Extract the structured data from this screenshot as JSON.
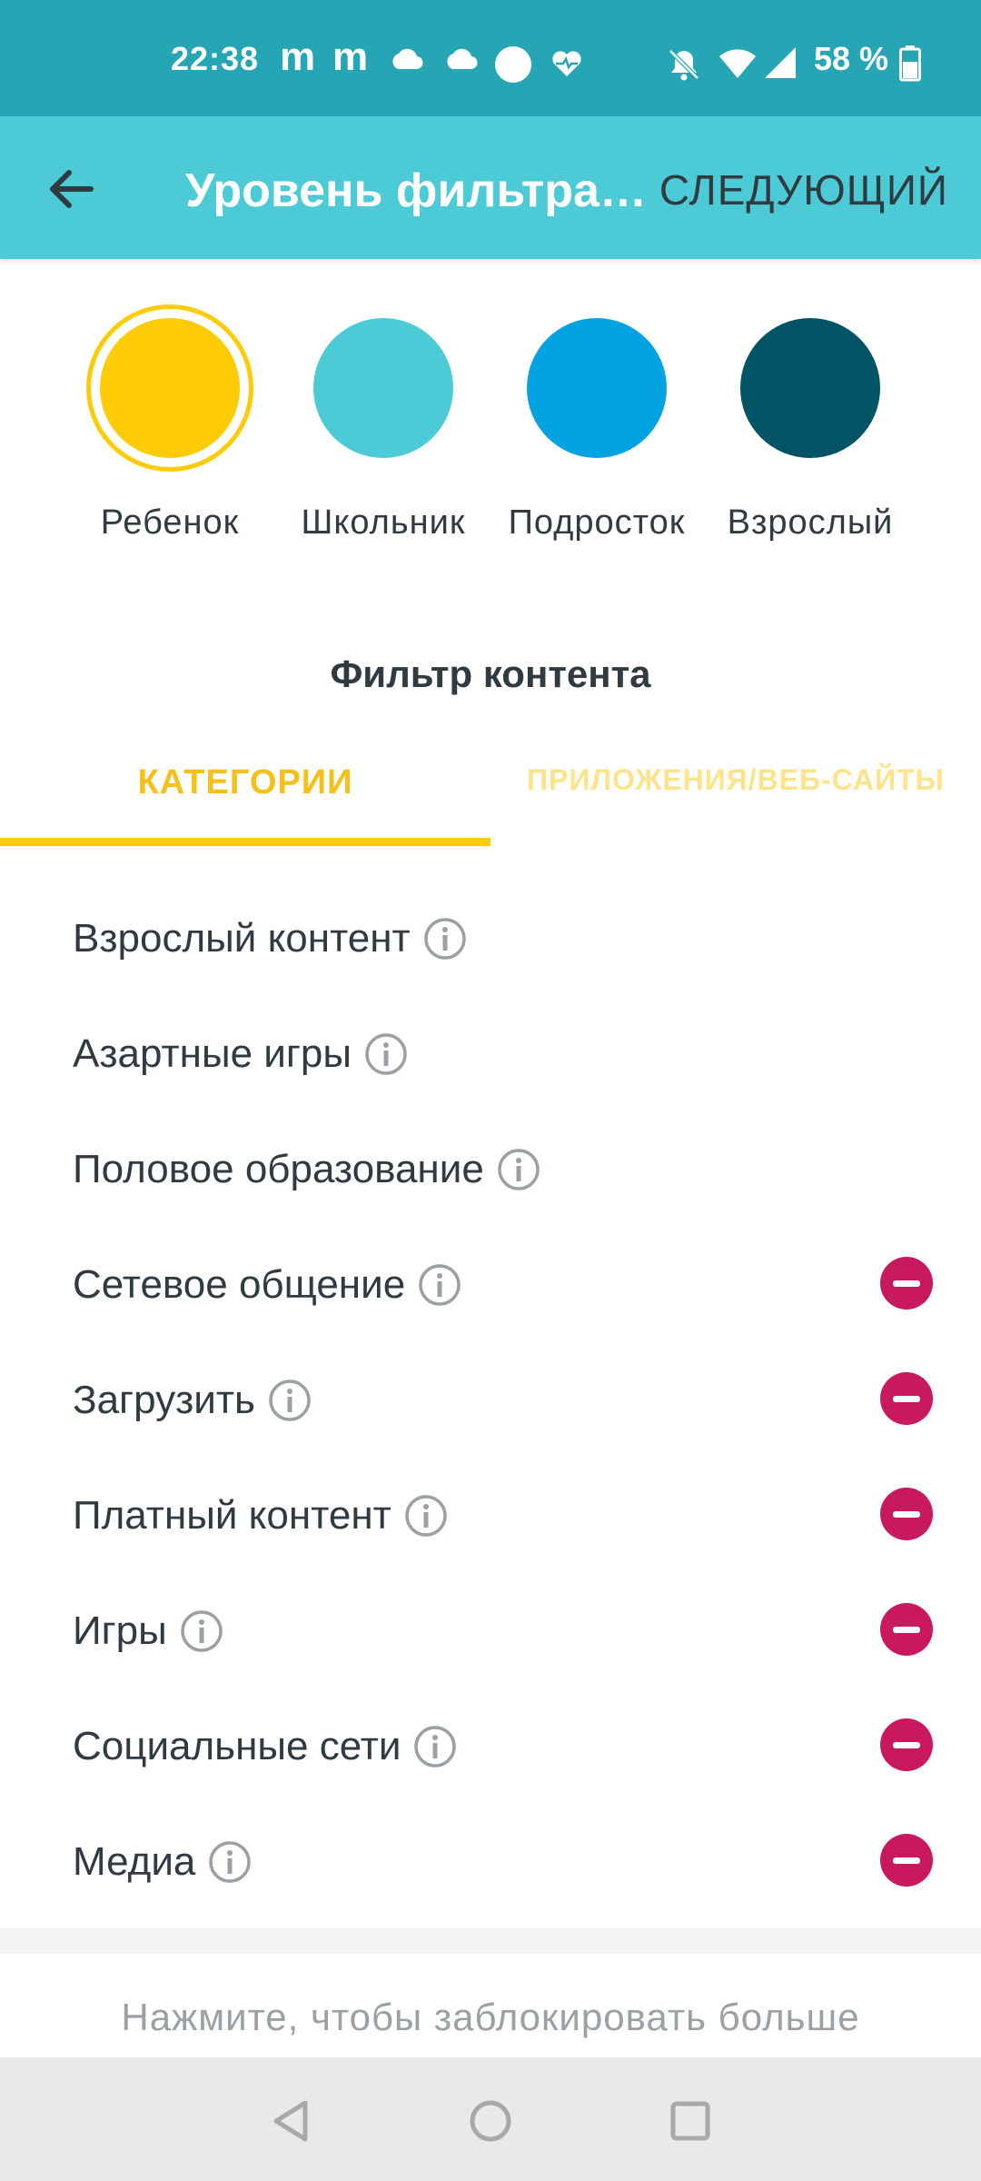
{
  "status_bar": {
    "time": "22:38",
    "notif_m1": "m",
    "notif_m2": "m",
    "battery_percent": "58 %",
    "icons": [
      "cloud-icon",
      "cloud-icon",
      "circle-icon",
      "heart-pulse-icon",
      "bell-off-icon",
      "wifi-icon",
      "signal-icon",
      "battery-icon"
    ]
  },
  "app_bar": {
    "title": "Уровень фильтрации",
    "next_label": "СЛЕДУЮЩИЙ",
    "back_icon": "arrow-left-icon",
    "background": "#4ccad6"
  },
  "levels": [
    {
      "label": "Ребенок",
      "color": "#ffcb05",
      "selected": true
    },
    {
      "label": "Школьник",
      "color": "#4ccad6",
      "selected": false
    },
    {
      "label": "Подросток",
      "color": "#03a3e2",
      "selected": false
    },
    {
      "label": "Взрослый",
      "color": "#005466",
      "selected": false
    }
  ],
  "content_filter": {
    "title": "Фильтр контента",
    "tabs": [
      {
        "label": "КАТЕГОРИИ",
        "active": true
      },
      {
        "label": "ПРИЛОЖЕНИЯ/ВЕБ-САЙТЫ",
        "active": false
      }
    ],
    "categories": [
      {
        "label": "Взрослый контент",
        "blockable": false
      },
      {
        "label": "Азартные игры",
        "blockable": false
      },
      {
        "label": "Половое образование",
        "blockable": false
      },
      {
        "label": "Сетевое общение",
        "blockable": true
      },
      {
        "label": "Загрузить",
        "blockable": true
      },
      {
        "label": "Платный контент",
        "blockable": true
      },
      {
        "label": "Игры",
        "blockable": true
      },
      {
        "label": "Социальные сети",
        "blockable": true
      },
      {
        "label": "Медиа",
        "blockable": true
      }
    ],
    "bottom_note": "Нажмите, чтобы заблокировать больше"
  },
  "colors": {
    "accent": "#ffcb05",
    "block": "#c8195f",
    "status_bar": "#26a6b4"
  },
  "nav_bar": {
    "icons": [
      "back-triangle-icon",
      "home-circle-icon",
      "recents-square-icon"
    ]
  }
}
